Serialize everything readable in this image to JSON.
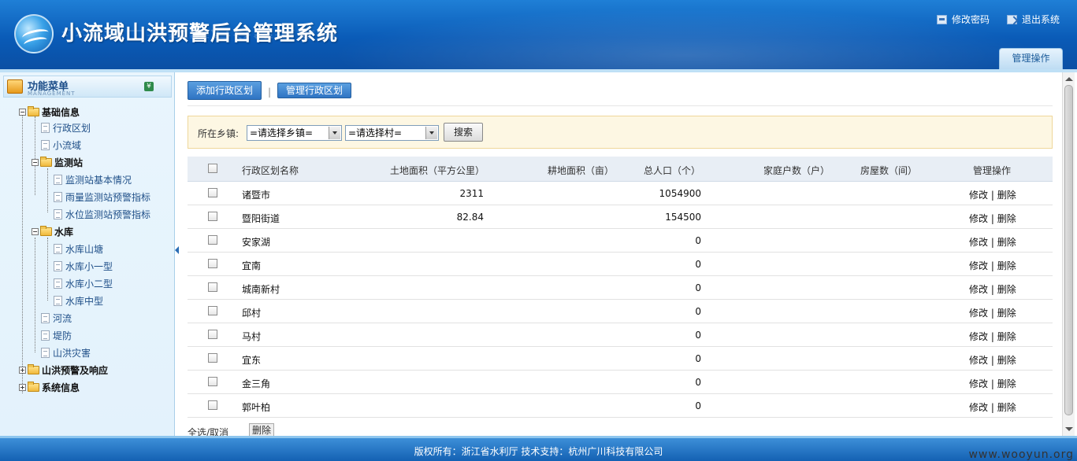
{
  "header": {
    "title": "小流域山洪预警后台管理系统",
    "links": [
      {
        "label": "修改密码",
        "icon": "key-icon"
      },
      {
        "label": "退出系统",
        "icon": "exit-icon"
      }
    ],
    "tab_label": "管理操作"
  },
  "sidebar": {
    "title": "功能菜单",
    "subtitle": "MANAGEMENT",
    "tree": {
      "basic": "基础信息",
      "admin_division": "行政区划",
      "small_basin": "小流域",
      "monitor_station": "监测站",
      "station_basic": "监测站基本情况",
      "rain_warning": "雨量监测站预警指标",
      "water_warning": "水位监测站预警指标",
      "reservoir": "水库",
      "pond": "水库山塘",
      "small1": "水库小一型",
      "small2": "水库小二型",
      "medium": "水库中型",
      "river": "河流",
      "dike": "堤防",
      "disaster": "山洪灾害",
      "flood_warning": "山洪预警及响应",
      "system_info": "系统信息"
    }
  },
  "main": {
    "add_button": "添加行政区划",
    "separator": "|",
    "manage_button": "管理行政区划",
    "filter": {
      "label": "所在乡镇:",
      "town_select": "=请选择乡镇=",
      "village_select": "=请选择村=",
      "search_button": "搜索"
    },
    "table": {
      "columns": [
        "行政区划名称",
        "土地面积（平方公里）",
        "耕地面积（亩）",
        "总人口（个）",
        "家庭户数（户）",
        "房屋数（间）",
        "管理操作"
      ],
      "rows": [
        {
          "name": "诸暨市",
          "land": "2311",
          "farm": "",
          "population": "1054900",
          "households": "",
          "houses": ""
        },
        {
          "name": "暨阳街道",
          "land": "82.84",
          "farm": "",
          "population": "154500",
          "households": "",
          "houses": ""
        },
        {
          "name": "安家湖",
          "land": "",
          "farm": "",
          "population": "0",
          "households": "",
          "houses": ""
        },
        {
          "name": "宜南",
          "land": "",
          "farm": "",
          "population": "0",
          "households": "",
          "houses": ""
        },
        {
          "name": "城南新村",
          "land": "",
          "farm": "",
          "population": "0",
          "households": "",
          "houses": ""
        },
        {
          "name": "邱村",
          "land": "",
          "farm": "",
          "population": "0",
          "households": "",
          "houses": ""
        },
        {
          "name": "马村",
          "land": "",
          "farm": "",
          "population": "0",
          "households": "",
          "houses": ""
        },
        {
          "name": "宜东",
          "land": "",
          "farm": "",
          "population": "0",
          "households": "",
          "houses": ""
        },
        {
          "name": "金三角",
          "land": "",
          "farm": "",
          "population": "0",
          "households": "",
          "houses": ""
        },
        {
          "name": "郭叶柏",
          "land": "",
          "farm": "",
          "population": "0",
          "households": "",
          "houses": ""
        }
      ],
      "edit_label": "修改",
      "op_sep": "|",
      "delete_label": "删除"
    },
    "bottom": {
      "select_all": "全选/取消",
      "delete_button": "删除"
    }
  },
  "footer": {
    "text": "版权所有：浙江省水利厅    技术支持：杭州广川科技有限公司",
    "watermark": "www.wooyun.org"
  }
}
